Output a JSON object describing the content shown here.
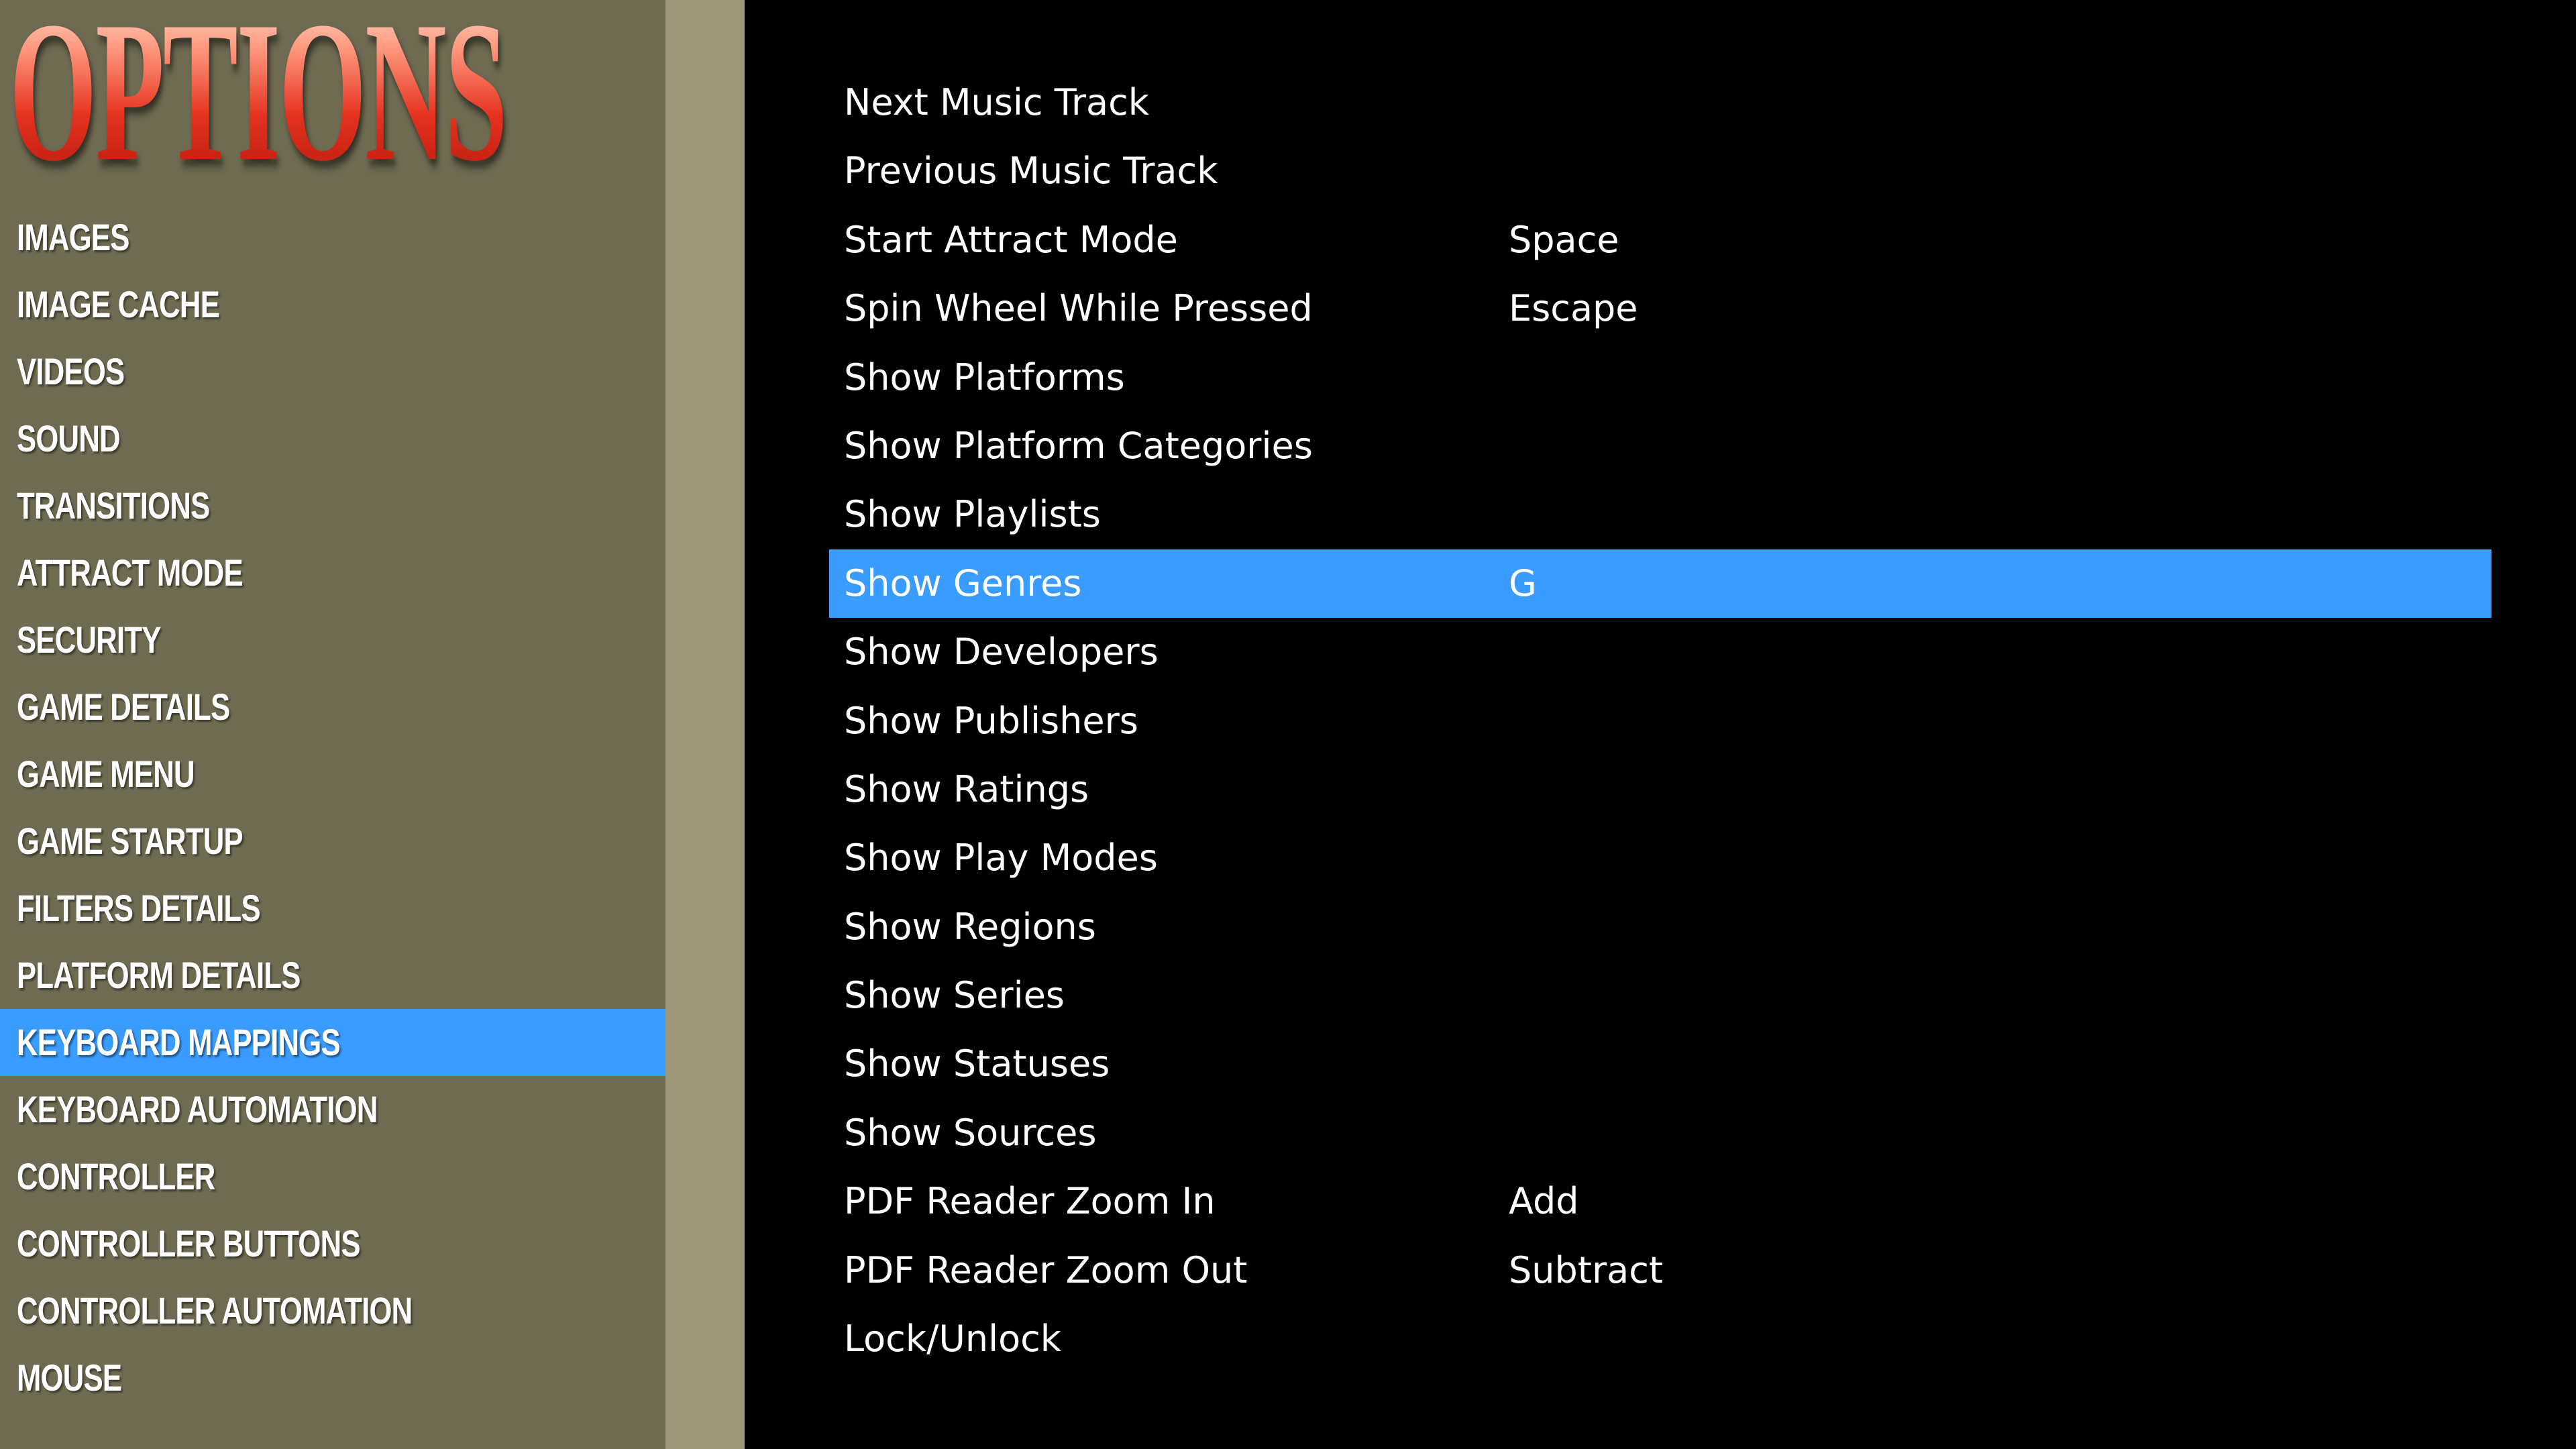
{
  "sidebar": {
    "title": "OPTIONS",
    "items": [
      {
        "label": "IMAGES",
        "selected": false
      },
      {
        "label": "IMAGE CACHE",
        "selected": false
      },
      {
        "label": "VIDEOS",
        "selected": false
      },
      {
        "label": "SOUND",
        "selected": false
      },
      {
        "label": "TRANSITIONS",
        "selected": false
      },
      {
        "label": "ATTRACT MODE",
        "selected": false
      },
      {
        "label": "SECURITY",
        "selected": false
      },
      {
        "label": "GAME DETAILS",
        "selected": false
      },
      {
        "label": "GAME MENU",
        "selected": false
      },
      {
        "label": "GAME STARTUP",
        "selected": false
      },
      {
        "label": "FILTERS DETAILS",
        "selected": false
      },
      {
        "label": "PLATFORM DETAILS",
        "selected": false
      },
      {
        "label": "KEYBOARD MAPPINGS",
        "selected": true
      },
      {
        "label": "KEYBOARD AUTOMATION",
        "selected": false
      },
      {
        "label": "CONTROLLER",
        "selected": false
      },
      {
        "label": "CONTROLLER BUTTONS",
        "selected": false
      },
      {
        "label": "CONTROLLER AUTOMATION",
        "selected": false
      },
      {
        "label": "MOUSE",
        "selected": false
      }
    ]
  },
  "mappings": {
    "rows": [
      {
        "action": "Next Music Track",
        "key": "",
        "selected": false
      },
      {
        "action": "Previous Music Track",
        "key": "",
        "selected": false
      },
      {
        "action": "Start Attract Mode",
        "key": "Space",
        "selected": false
      },
      {
        "action": "Spin Wheel While Pressed",
        "key": "Escape",
        "selected": false
      },
      {
        "action": "Show Platforms",
        "key": "",
        "selected": false
      },
      {
        "action": "Show Platform Categories",
        "key": "",
        "selected": false
      },
      {
        "action": "Show Playlists",
        "key": "",
        "selected": false
      },
      {
        "action": "Show Genres",
        "key": "G",
        "selected": true
      },
      {
        "action": "Show Developers",
        "key": "",
        "selected": false
      },
      {
        "action": "Show Publishers",
        "key": "",
        "selected": false
      },
      {
        "action": "Show Ratings",
        "key": "",
        "selected": false
      },
      {
        "action": "Show Play Modes",
        "key": "",
        "selected": false
      },
      {
        "action": "Show Regions",
        "key": "",
        "selected": false
      },
      {
        "action": "Show Series",
        "key": "",
        "selected": false
      },
      {
        "action": "Show Statuses",
        "key": "",
        "selected": false
      },
      {
        "action": "Show Sources",
        "key": "",
        "selected": false
      },
      {
        "action": "PDF Reader Zoom In",
        "key": "Add",
        "selected": false
      },
      {
        "action": "PDF Reader Zoom Out",
        "key": "Subtract",
        "selected": false
      },
      {
        "action": "Lock/Unlock",
        "key": "",
        "selected": false
      }
    ]
  },
  "colors": {
    "sidebar_bg": "#6f6b52",
    "divider_bg": "#9c977b",
    "content_bg": "#000000",
    "selection": "#3a9cff",
    "title_red": "#e53b26",
    "text": "#ffffff"
  }
}
